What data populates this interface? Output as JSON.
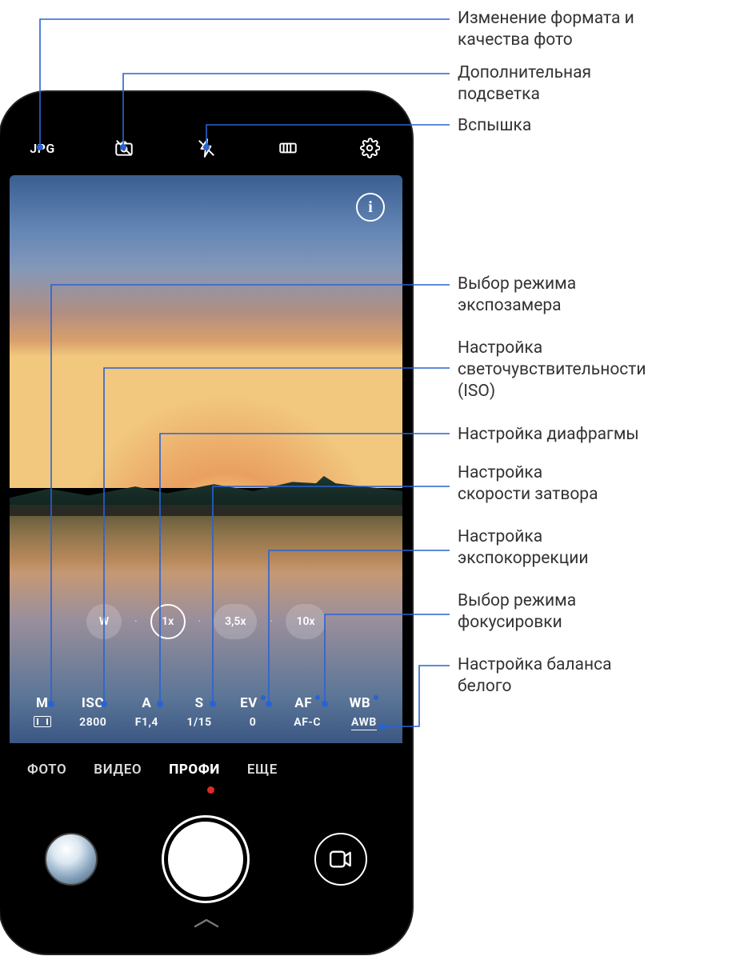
{
  "callouts": {
    "format": "Изменение формата и\nкачества фото",
    "backlight": "Дополнительная\nподсветка",
    "flash": "Вспышка",
    "metering": "Выбор режима\nэкспозамера",
    "iso": "Настройка\nсветочувствительности\n(ISO)",
    "aperture": "Настройка диафрагмы",
    "shutter": "Настройка\nскорости затвора",
    "ev": "Настройка\nэкспокоррекции",
    "focus": "Выбор режима\nфокусировки",
    "wb": "Настройка баланса\nбелого"
  },
  "topbar": {
    "format_label": "JPG"
  },
  "info_icon": "i",
  "zoom": {
    "w": "W",
    "x1": "1x",
    "x35": "3,5x",
    "x10": "10x"
  },
  "params": {
    "metering": {
      "label": "M"
    },
    "iso": {
      "label": "ISO",
      "value": "2800"
    },
    "aperture": {
      "label": "A",
      "value": "F1,4"
    },
    "shutter": {
      "label": "S",
      "value": "1/15"
    },
    "ev": {
      "label": "EV",
      "value": "0"
    },
    "af": {
      "label": "AF",
      "value": "AF-C"
    },
    "wb": {
      "label": "WB",
      "value": "AWB"
    }
  },
  "tabs": {
    "photo": "ФОТО",
    "video": "ВИДЕО",
    "pro": "ПРОФИ",
    "more": "ЕЩЕ"
  }
}
